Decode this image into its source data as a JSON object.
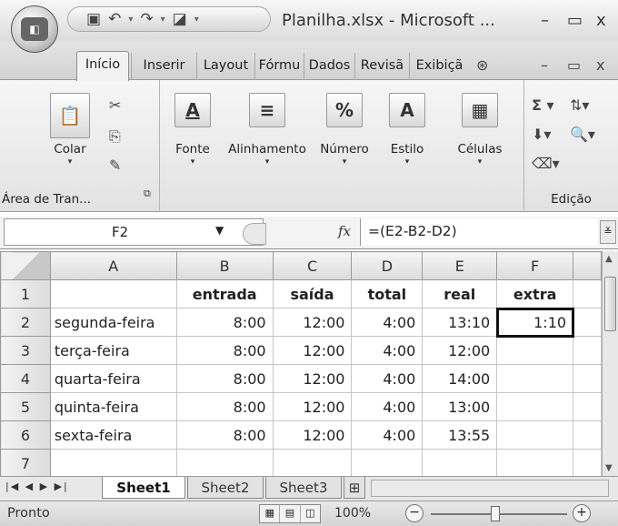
{
  "window": {
    "title": "Planilha.xlsx - Microsoft ...",
    "office_logo": "",
    "minimize": "–",
    "maximize": "▭",
    "close": "x"
  },
  "quick_access": {
    "save_icon": "save-icon",
    "undo_icon": "undo-icon",
    "redo_icon": "redo-icon",
    "print_preview_icon": "print-preview-icon"
  },
  "ribbon_tabs": [
    "Início",
    "Inserir",
    "Layout",
    "Fórmu",
    "Dados",
    "Revisã",
    "Exibiçã"
  ],
  "ribbon_right": {
    "help": "?",
    "minimize": "–",
    "restore": "▭",
    "close": "x"
  },
  "ribbon": {
    "clipboard": {
      "paste_label": "Colar",
      "group_label": "Área de Tran..."
    },
    "font": {
      "label": "Fonte"
    },
    "alignment": {
      "label": "Alinhamento"
    },
    "number": {
      "label": "Número"
    },
    "styles": {
      "label": "Estilo"
    },
    "cells": {
      "label": "Células"
    },
    "editing": {
      "group_label": "Edição"
    }
  },
  "formula_bar": {
    "name_box": "F2",
    "fx": "fx",
    "formula": "=(E2-B2-D2)"
  },
  "grid": {
    "columns": [
      "A",
      "B",
      "C",
      "D",
      "E",
      "F"
    ],
    "rows": [
      {
        "num": "1",
        "cells": [
          "",
          "entrada",
          "saída",
          "total",
          "real",
          "extra"
        ]
      },
      {
        "num": "2",
        "cells": [
          "segunda-feira",
          "8:00",
          "12:00",
          "4:00",
          "13:10",
          "1:10"
        ]
      },
      {
        "num": "3",
        "cells": [
          "terça-feira",
          "8:00",
          "12:00",
          "4:00",
          "12:00",
          ""
        ]
      },
      {
        "num": "4",
        "cells": [
          "quarta-feira",
          "8:00",
          "12:00",
          "4:00",
          "14:00",
          ""
        ]
      },
      {
        "num": "5",
        "cells": [
          "quinta-feira",
          "8:00",
          "12:00",
          "4:00",
          "13:00",
          ""
        ]
      },
      {
        "num": "6",
        "cells": [
          "sexta-feira",
          "8:00",
          "12:00",
          "4:00",
          "13:55",
          ""
        ]
      },
      {
        "num": "7",
        "cells": [
          "",
          "",
          "",
          "",
          "",
          ""
        ]
      }
    ],
    "selected_cell": "F2"
  },
  "sheets": [
    {
      "name": "Sheet1",
      "active": true
    },
    {
      "name": "Sheet2",
      "active": false
    },
    {
      "name": "Sheet3",
      "active": false
    }
  ],
  "status": {
    "text": "Pronto",
    "zoom": "100%"
  }
}
